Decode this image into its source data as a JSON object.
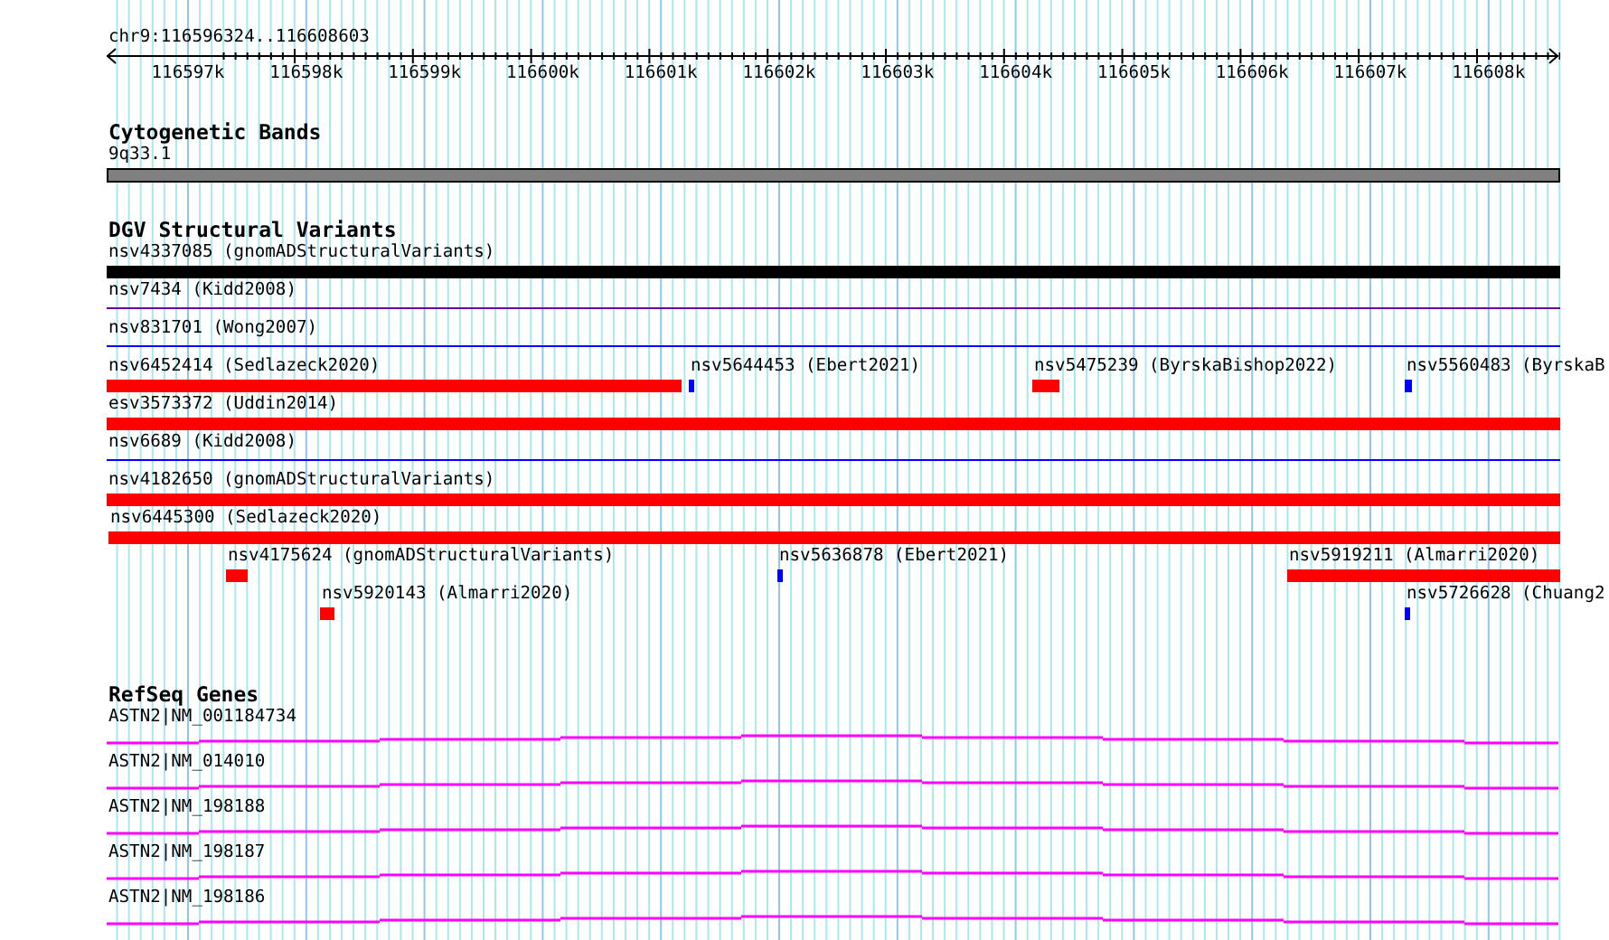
{
  "location": "chr9:116596324..116608603",
  "ruler": {
    "ticks": [
      "116597k",
      "116598k",
      "116599k",
      "116600k",
      "116601k",
      "116602k",
      "116603k",
      "116604k",
      "116605k",
      "116606k",
      "116607k",
      "116608k"
    ]
  },
  "cytobands": {
    "title": "Cytogenetic Bands",
    "band": "9q33.1"
  },
  "variants": {
    "title": "DGV Structural Variants",
    "lanes": [
      {
        "features": [
          {
            "label": "nsv4337085 (gnomADStructuralVariants)",
            "kind": "bar",
            "color": "#000000"
          }
        ]
      },
      {
        "features": [
          {
            "label": "nsv7434 (Kidd2008)",
            "kind": "line",
            "color": "#660099"
          }
        ]
      },
      {
        "features": [
          {
            "label": "nsv831701 (Wong2007)",
            "kind": "line",
            "color": "#0000ff"
          }
        ]
      },
      {
        "features": [
          {
            "label": "nsv6452414 (Sedlazeck2020)",
            "kind": "bar",
            "color": "#ff0000"
          },
          {
            "label": "nsv5644453 (Ebert2021)",
            "kind": "bar",
            "color": "#0000ff"
          },
          {
            "label": "nsv5475239 (ByrskaBishop2022)",
            "kind": "bar",
            "color": "#ff0000"
          },
          {
            "label": "nsv5560483 (ByrskaB",
            "kind": "bar",
            "color": "#0000ff"
          }
        ]
      },
      {
        "features": [
          {
            "label": "esv3573372 (Uddin2014)",
            "kind": "bar",
            "color": "#ff0000"
          }
        ]
      },
      {
        "features": [
          {
            "label": "nsv6689 (Kidd2008)",
            "kind": "line",
            "color": "#0000ff"
          }
        ]
      },
      {
        "features": [
          {
            "label": "nsv4182650 (gnomADStructuralVariants)",
            "kind": "bar",
            "color": "#ff0000"
          }
        ]
      },
      {
        "features": [
          {
            "label": "nsv6445300 (Sedlazeck2020)",
            "kind": "bar",
            "color": "#ff0000"
          }
        ]
      },
      {
        "features": [
          {
            "label": "nsv4175624 (gnomADStructuralVariants)",
            "kind": "bar",
            "color": "#ff0000"
          },
          {
            "label": "nsv5636878 (Ebert2021)",
            "kind": "bar",
            "color": "#0000ff"
          },
          {
            "label": "nsv5919211 (Almarri2020)",
            "kind": "bar",
            "color": "#ff0000"
          }
        ]
      },
      {
        "features": [
          {
            "label": "nsv5920143 (Almarri2020)",
            "kind": "bar",
            "color": "#ff0000"
          },
          {
            "label": "nsv5726628 (Chuang2",
            "kind": "bar",
            "color": "#0000ff"
          }
        ]
      }
    ]
  },
  "genes": {
    "title": "RefSeq Genes",
    "transcripts": [
      "ASTN2|NM_001184734",
      "ASTN2|NM_014010",
      "ASTN2|NM_198188",
      "ASTN2|NM_198187",
      "ASTN2|NM_198186"
    ]
  }
}
